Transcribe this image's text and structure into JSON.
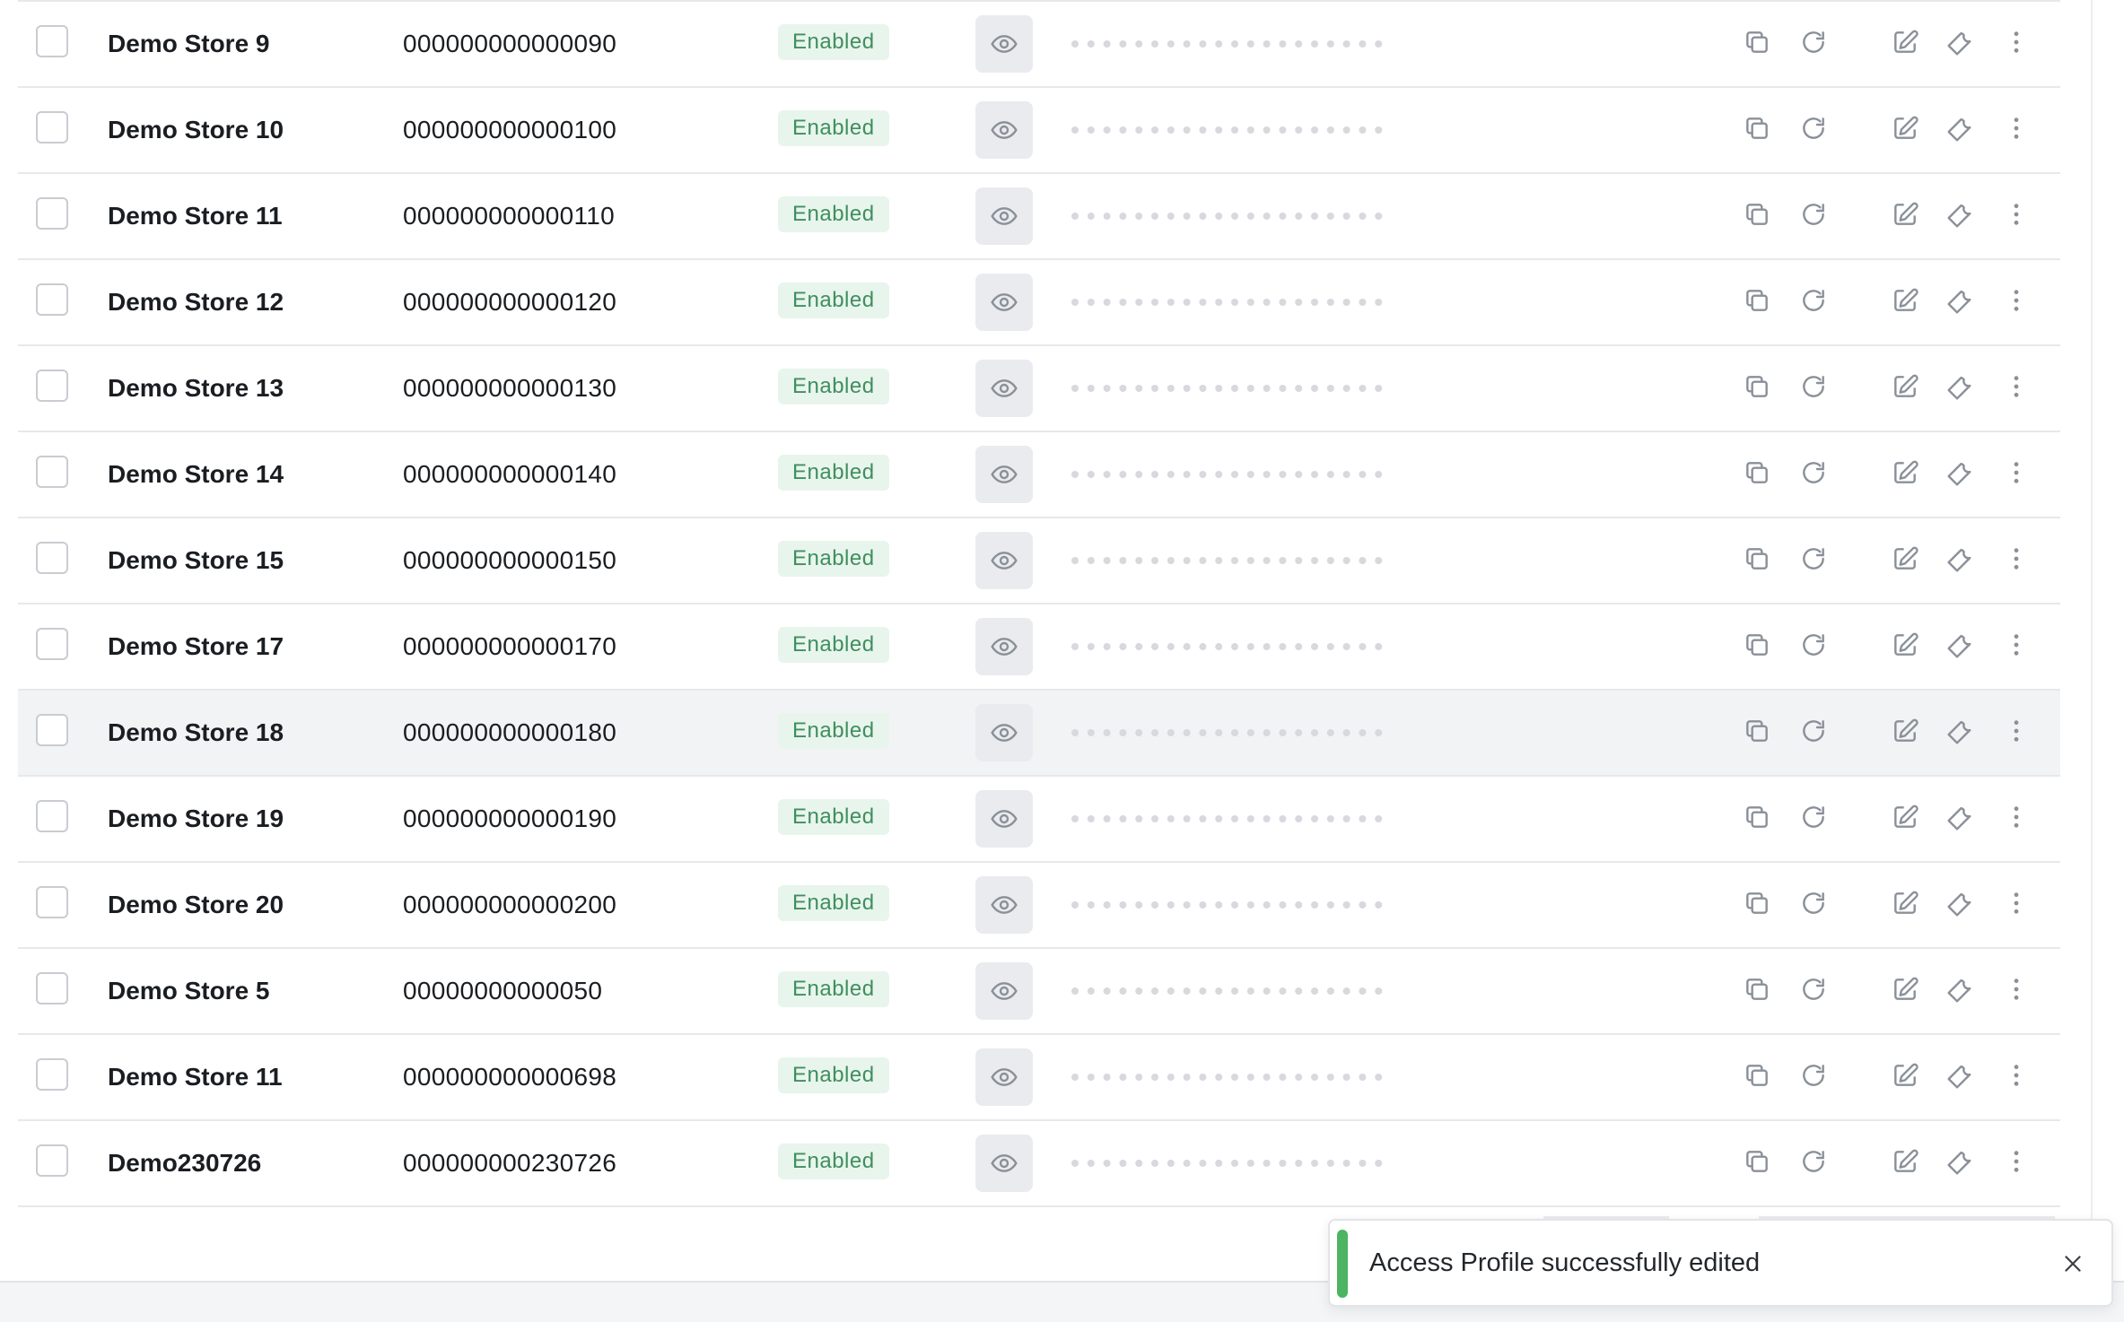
{
  "rows": [
    {
      "name": "Demo Store 9",
      "code": "000000000000090",
      "status": "Enabled"
    },
    {
      "name": "Demo Store 10",
      "code": "000000000000100",
      "status": "Enabled"
    },
    {
      "name": "Demo Store 11",
      "code": "000000000000110",
      "status": "Enabled"
    },
    {
      "name": "Demo Store 12",
      "code": "000000000000120",
      "status": "Enabled"
    },
    {
      "name": "Demo Store 13",
      "code": "000000000000130",
      "status": "Enabled"
    },
    {
      "name": "Demo Store 14",
      "code": "000000000000140",
      "status": "Enabled"
    },
    {
      "name": "Demo Store 15",
      "code": "000000000000150",
      "status": "Enabled"
    },
    {
      "name": "Demo Store 17",
      "code": "000000000000170",
      "status": "Enabled"
    },
    {
      "name": "Demo Store 18",
      "code": "000000000000180",
      "status": "Enabled"
    },
    {
      "name": "Demo Store 19",
      "code": "000000000000190",
      "status": "Enabled"
    },
    {
      "name": "Demo Store 20",
      "code": "000000000000200",
      "status": "Enabled"
    },
    {
      "name": "Demo Store 5",
      "code": "00000000000050",
      "status": "Enabled"
    },
    {
      "name": "Demo Store 11",
      "code": "000000000000698",
      "status": "Enabled"
    },
    {
      "name": "Demo230726",
      "code": "000000000230726",
      "status": "Enabled"
    }
  ],
  "icons": {
    "visibility": "eye-icon",
    "copy": "copy-icon",
    "refresh": "refresh-icon",
    "edit": "edit-icon",
    "settings": "wrench-icon",
    "more": "more-vertical-icon",
    "close": "close-icon"
  },
  "toast": {
    "message": "Access Profile successfully edited",
    "accent_color": "#4cb462"
  },
  "colors": {
    "status_bg": "#e8f5ec",
    "status_text": "#3f8f5f",
    "row_hover": "#f1f3f5"
  }
}
